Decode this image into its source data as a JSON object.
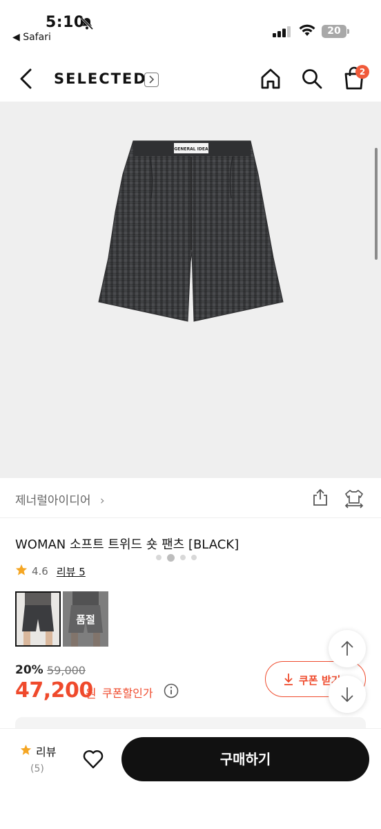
{
  "status_bar": {
    "time": "5:10",
    "back_app": "◀ Safari",
    "battery": "20"
  },
  "header": {
    "brand": "SELECTED",
    "cart_count": "2"
  },
  "gallery": {
    "tag_text": "GENERAL IDEA"
  },
  "brand_row": {
    "brand_name": "제너럴아이디어",
    "chevron": "›"
  },
  "product": {
    "title": "WOMAN 소프트 트위드 숏 팬츠 [BLACK]",
    "rating": "4.6",
    "review_label": "리뷰 5",
    "thumbnails": [
      {
        "label": ""
      },
      {
        "label": "품절"
      }
    ]
  },
  "price": {
    "discount": "20%",
    "original": "59,000",
    "final": "47,200",
    "unit": "원",
    "coupon_note": "쿠폰할인가",
    "coupon_button": "쿠폰 받기"
  },
  "bottom_bar": {
    "review_label": "리뷰",
    "review_count": "(5)",
    "buy_label": "구매하기"
  },
  "colors": {
    "accent": "#ef4a2c",
    "badge": "#f05a3a",
    "buy_button": "#111111",
    "star": "#f5a623"
  },
  "icons": [
    "bell-slash-icon",
    "signal-icon",
    "wifi-icon",
    "back-arrow-icon",
    "home-icon",
    "search-icon",
    "shopping-bag-icon",
    "share-icon",
    "compare-icon",
    "star-icon",
    "info-icon",
    "download-icon",
    "arrow-up-icon",
    "arrow-down-icon",
    "heart-icon"
  ]
}
